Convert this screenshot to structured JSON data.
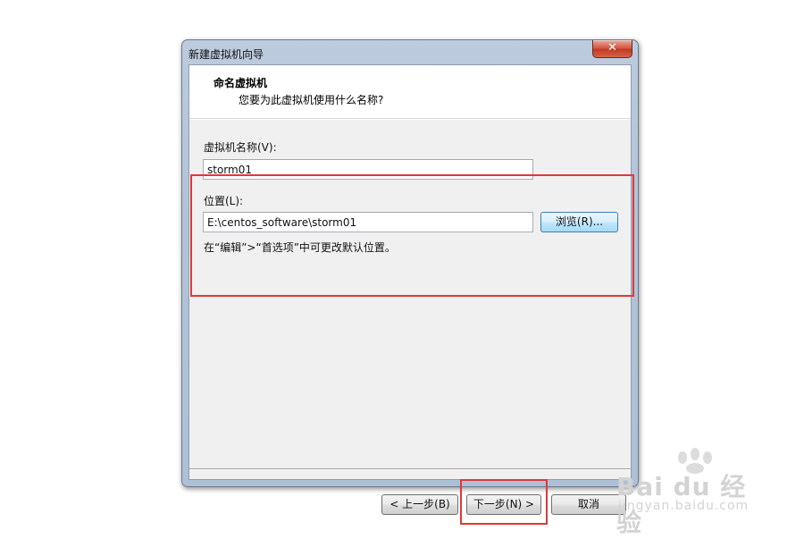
{
  "window": {
    "title": "新建虚拟机向导",
    "close_glyph": "✕"
  },
  "header": {
    "title": "命名虚拟机",
    "subtitle": "您要为此虚拟机使用什么名称?"
  },
  "form": {
    "name_label": "虚拟机名称(V):",
    "name_value": "storm01",
    "location_label": "位置(L):",
    "location_value": "E:\\centos_software\\storm01",
    "browse_label": "浏览(R)...",
    "hint": "在“编辑”>“首选项”中可更改默认位置。"
  },
  "footer": {
    "back_label": "< 上一步(B)",
    "next_label": "下一步(N) >",
    "cancel_label": "取消"
  },
  "watermark": {
    "brand": "Bai du 经验",
    "url": "jingyan.baidu.com"
  },
  "colors": {
    "highlight": "#e03838",
    "close_button": "#c23a22",
    "window_frame": "#b2c3d8"
  }
}
